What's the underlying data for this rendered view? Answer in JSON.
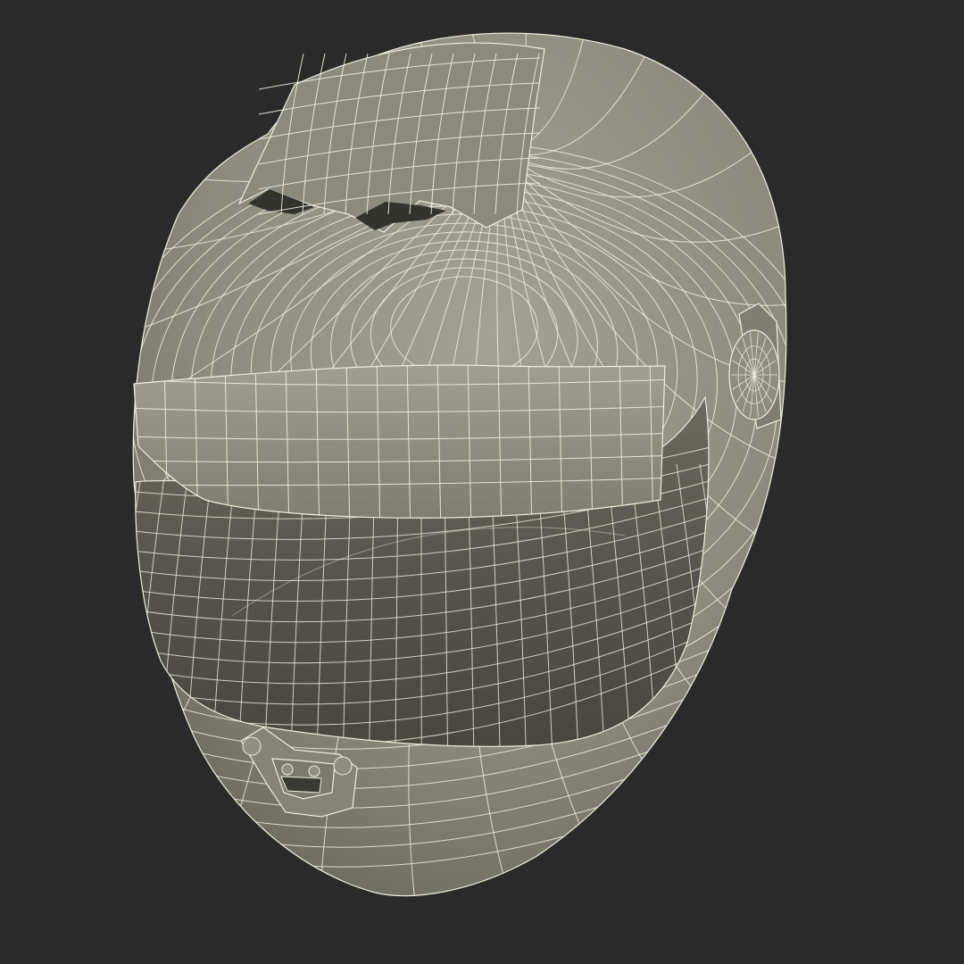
{
  "viewport": {
    "background": "#2a2a2a",
    "subject": "helmet-wireframe-model",
    "display_mode": "shaded-with-wireframe"
  },
  "colors": {
    "shell": "#8c8b7e",
    "shell_shadow": "#6e6d62",
    "shell_light": "#a3a294",
    "wire": "#eeeedd",
    "visor": "#4b4b44",
    "visor_highlight": "#6a6a60",
    "vent_dark": "#33332e"
  }
}
